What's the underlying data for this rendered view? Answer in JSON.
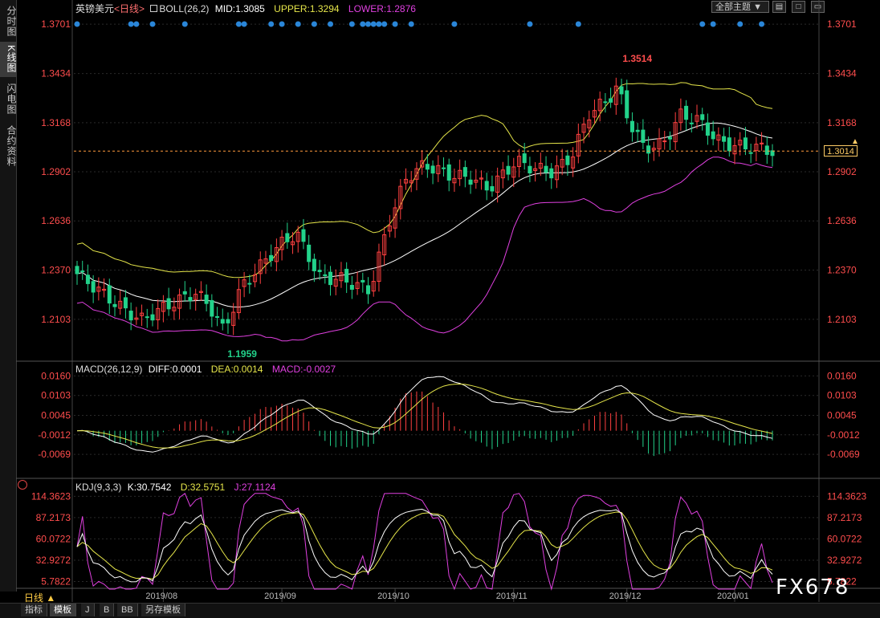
{
  "sidebar": [
    {
      "label": "分时图"
    },
    {
      "label": "K线图"
    },
    {
      "label": "闪电图"
    },
    {
      "label": "合约资料"
    }
  ],
  "header": {
    "instrument": "英镑美元",
    "period": "<日线>",
    "indicator": "BOLL(26,2)",
    "mid": "MID:1.3085",
    "upper": "UPPER:1.3294",
    "lower": "LOWER:1.2876",
    "theme_select": "全部主题",
    "window_buttons": [
      "▤",
      "□",
      "▭"
    ]
  },
  "macd_header": {
    "name": "MACD(26,12,9)",
    "diff": "DIFF:0.0001",
    "dea": "DEA:0.0014",
    "macd": "MACD:-0.0027"
  },
  "kdj_header": {
    "name": "KDJ(9,3,3)",
    "k": "K:30.7542",
    "d": "D:32.5751",
    "j": "J:27.1124"
  },
  "current_price": "1.3014",
  "period_button": "日线 ▲",
  "bottom_tabs": [
    "指标",
    "模板",
    "J",
    "B",
    "BB",
    "另存模板"
  ],
  "watermark": "FX678",
  "colors": {
    "up": "#ff4040",
    "down": "#22d28a",
    "mid": "#ffffff",
    "upper": "#e6e64a",
    "lower": "#e040e0",
    "axis_red": "#ff4d4d",
    "grid": "#2a2a2a",
    "dots": "#2a86d8"
  },
  "chart_data": [
    {
      "type": "candlestick",
      "title": "英镑美元<日线> BOLL(26,2)",
      "x_labels": [
        "2019/08",
        "2019/09",
        "2019/10",
        "2019/11",
        "2019/12",
        "2020/01"
      ],
      "y_ticks": [
        "1.3701",
        "1.3434",
        "1.3168",
        "1.2902",
        "1.2636",
        "1.2370",
        "1.2103"
      ],
      "ylim": [
        1.192,
        1.378
      ],
      "annotations": [
        {
          "text": "1.3514",
          "value": 1.3514
        },
        {
          "text": "1.1959",
          "value": 1.1959
        }
      ],
      "close_guide": 1.3014
    },
    {
      "type": "histogram+line",
      "title": "MACD(26,12,9)",
      "y_ticks": [
        "0.0160",
        "0.0103",
        "0.0045",
        "-0.0012",
        "-0.0069"
      ],
      "ylim": [
        -0.0125,
        0.0175
      ]
    },
    {
      "type": "line",
      "title": "KDJ(9,3,3)",
      "y_ticks": [
        "114.3623",
        "87.2173",
        "60.0722",
        "32.9272",
        "5.7822"
      ],
      "ylim": [
        -5,
        125
      ]
    }
  ]
}
